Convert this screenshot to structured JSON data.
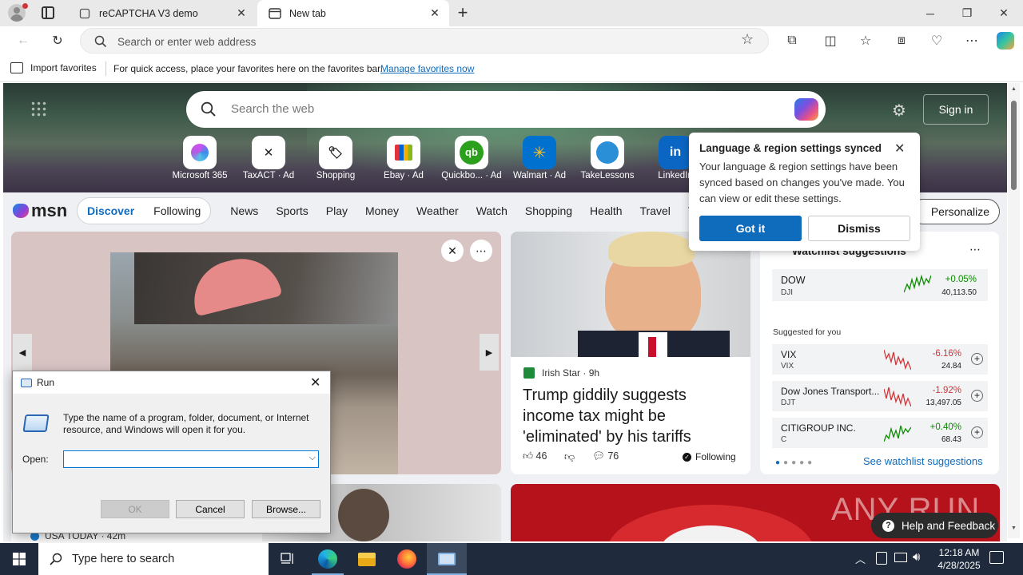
{
  "browser": {
    "tabs": [
      {
        "title": "reCAPTCHA V3 demo",
        "active": false
      },
      {
        "title": "New tab",
        "active": true
      }
    ],
    "address_placeholder": "Search or enter web address",
    "favorites_bar": {
      "import_label": "Import favorites",
      "hint": "For quick access, place your favorites here on the favorites bar.",
      "manage_link": "Manage favorites now"
    }
  },
  "msn": {
    "search_placeholder": "Search the web",
    "sign_in": "Sign in",
    "quick_links": [
      {
        "label": "Microsoft 365",
        "ad": false
      },
      {
        "label": "TaxACT",
        "ad": true
      },
      {
        "label": "Shopping",
        "ad": false
      },
      {
        "label": "Ebay",
        "ad": true
      },
      {
        "label": "Quickbo...",
        "ad": true
      },
      {
        "label": "Walmart",
        "ad": true
      },
      {
        "label": "TakeLessons",
        "ad": false
      },
      {
        "label": "LinkedIn",
        "ad": false
      }
    ],
    "ad_label": "Ad",
    "logo": "msn",
    "nav": {
      "discover": "Discover",
      "following": "Following",
      "items": [
        "News",
        "Sports",
        "Play",
        "Money",
        "Weather",
        "Watch",
        "Shopping",
        "Health",
        "Travel",
        "T"
      ],
      "personalize": "Personalize"
    },
    "news_card": {
      "source": "Irish Star",
      "age": "9h",
      "headline": "Trump giddily suggests income tax might be 'eliminated' by his tariffs",
      "likes": "46",
      "comments": "76",
      "following": "Following"
    },
    "bottom_source": "USA TODAY · 42m",
    "watchlist": {
      "title": "Watchlist suggestions",
      "main": {
        "name": "DOW",
        "symbol": "DJI",
        "change": "+0.05%",
        "price": "40,113.50"
      },
      "suggested_label": "Suggested for you",
      "items": [
        {
          "name": "VIX",
          "symbol": "VIX",
          "change": "-6.16%",
          "price": "24.84",
          "up": false
        },
        {
          "name": "Dow Jones Transport...",
          "symbol": "DJT",
          "change": "-1.92%",
          "price": "13,497.05",
          "up": false
        },
        {
          "name": "CITIGROUP INC.",
          "symbol": "C",
          "change": "+0.40%",
          "price": "68.43",
          "up": true
        }
      ],
      "see_link": "See watchlist suggestions"
    },
    "help_feedback": "Help and Feedback",
    "watermark": "ANY RUN"
  },
  "lang_popup": {
    "title": "Language & region settings synced",
    "body": "Your language & region settings have been synced based on changes you've made. You can view or edit these settings.",
    "got_it": "Got it",
    "dismiss": "Dismiss"
  },
  "run_dialog": {
    "title": "Run",
    "description": "Type the name of a program, folder, document, or Internet resource, and Windows will open it for you.",
    "open_label": "Open:",
    "open_value": "",
    "ok": "OK",
    "cancel": "Cancel",
    "browse": "Browse..."
  },
  "taskbar": {
    "search_placeholder": "Type here to search",
    "time": "12:18 AM",
    "date": "4/28/2025"
  },
  "colors": {
    "accent_blue": "#0f6cbd",
    "gain": "#0b8a00",
    "loss": "#d13438",
    "taskbar": "#1f2b3c"
  }
}
